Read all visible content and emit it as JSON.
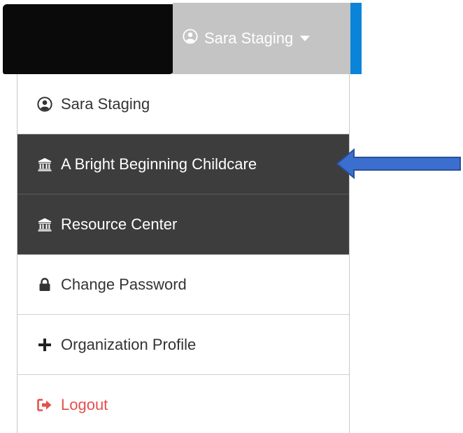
{
  "navbar": {
    "user_name": "Sara Staging",
    "accent_color": "#0a84d8",
    "toggle_bg": "#c4c4c4"
  },
  "menu": {
    "items": [
      {
        "label": "Sara Staging",
        "icon": "user-circle-icon",
        "style": "light"
      },
      {
        "label": "A Bright Beginning Childcare",
        "icon": "institution-icon",
        "style": "dark"
      },
      {
        "label": "Resource Center",
        "icon": "institution-icon",
        "style": "dark"
      },
      {
        "label": "Change Password",
        "icon": "lock-icon",
        "style": "light"
      },
      {
        "label": "Organization Profile",
        "icon": "plus-icon",
        "style": "light"
      },
      {
        "label": "Logout",
        "icon": "sign-out-icon",
        "style": "logout"
      }
    ],
    "dark_bg": "#3d3d3d",
    "logout_color": "#e4504c"
  },
  "annotation": {
    "arrow_color": "#3a6fd0",
    "points_to": "A Bright Beginning Childcare"
  }
}
